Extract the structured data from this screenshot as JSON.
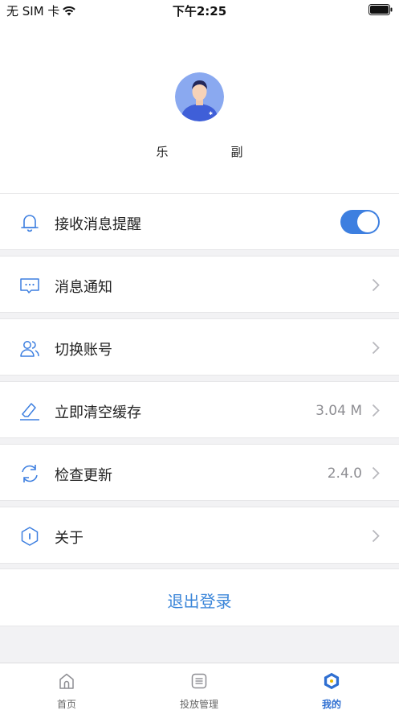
{
  "status_bar": {
    "carrier": "无 SIM 卡",
    "time": "下午2:25"
  },
  "profile": {
    "username_start": "乐",
    "username_end": "副"
  },
  "settings": {
    "notifications_toggle": {
      "label": "接收消息提醒",
      "on": true
    },
    "items": [
      {
        "label": "消息通知",
        "value": ""
      },
      {
        "label": "切换账号",
        "value": ""
      },
      {
        "label": "立即清空缓存",
        "value": "3.04 M"
      },
      {
        "label": "检查更新",
        "value": "2.4.0"
      },
      {
        "label": "关于",
        "value": ""
      }
    ]
  },
  "logout_label": "退出登录",
  "tabbar": {
    "tabs": [
      {
        "label": "首页",
        "icon": "home-icon",
        "active": false
      },
      {
        "label": "投放管理",
        "icon": "list-icon",
        "active": false
      },
      {
        "label": "我的",
        "icon": "profile-hex-icon",
        "active": true
      }
    ]
  },
  "colors": {
    "accent": "#3d7fe0",
    "link": "#3b86d9",
    "background": "#f2f2f4"
  }
}
